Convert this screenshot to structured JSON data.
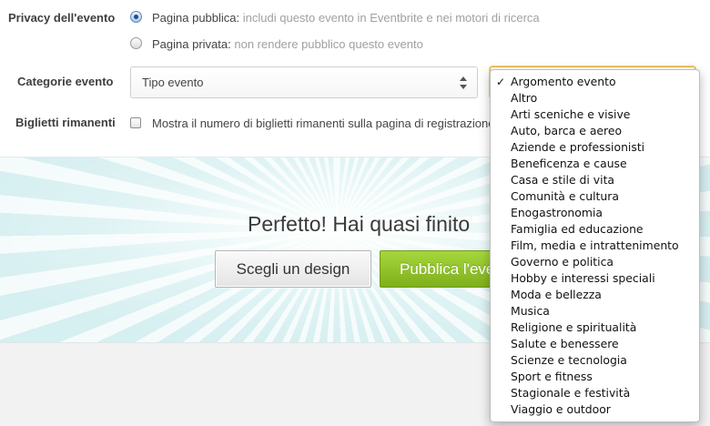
{
  "privacy": {
    "label": "Privacy dell'evento",
    "public_label": "Pagina pubblica:",
    "public_desc": "includi questo evento in Eventbrite e nei motori di ricerca",
    "private_label": "Pagina privata:",
    "private_desc": "non rendere pubblico questo evento",
    "selected": "public"
  },
  "categories": {
    "label": "Categorie evento",
    "type_select_value": "Tipo evento",
    "topic_select_value": "Argomento evento"
  },
  "tickets": {
    "label": "Biglietti rimanenti",
    "checkbox_label": "Mostra il numero di biglietti rimanenti sulla pagina di registrazione",
    "checked": false
  },
  "banner": {
    "title": "Perfetto! Hai quasi finito",
    "design_button": "Scegli un design",
    "publish_button": "Pubblica l'evento"
  },
  "dropdown": {
    "checkmark": "✓",
    "options": [
      "Argomento evento",
      "Altro",
      "Arti sceniche e visive",
      "Auto, barca e aereo",
      "Aziende e professionisti",
      "Beneficenza e cause",
      "Casa e stile di vita",
      "Comunità e cultura",
      "Enogastronomia",
      "Famiglia ed educazione",
      "Film, media e intrattenimento",
      "Governo e politica",
      "Hobby e interessi speciali",
      "Moda e bellezza",
      "Musica",
      "Religione e spiritualità",
      "Salute e benessere",
      "Scienze e tecnologia",
      "Sport e fitness",
      "Stagionale e festività",
      "Viaggio e outdoor"
    ]
  },
  "colors": {
    "publish_green": "#8cc22a",
    "banner_teal": "#d6eff1",
    "focus_orange": "#e8b84a"
  }
}
